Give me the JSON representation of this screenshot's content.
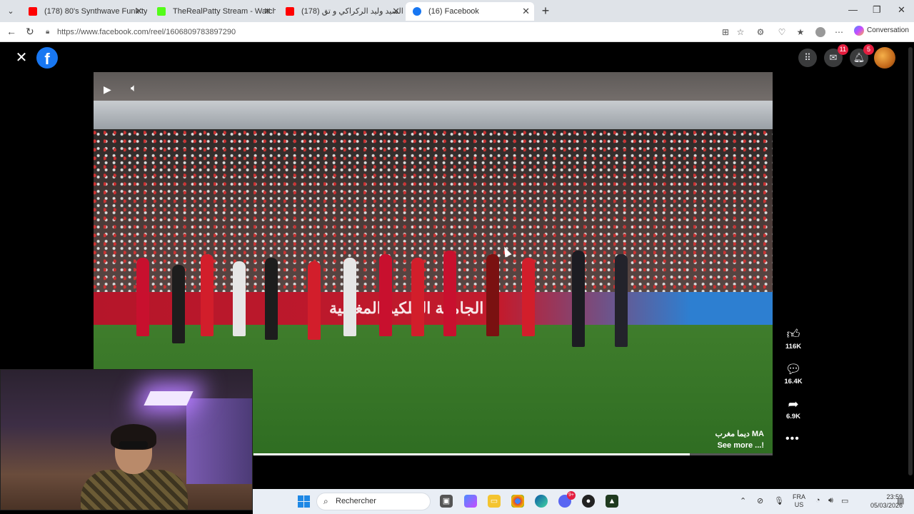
{
  "browser": {
    "tabs": [
      {
        "title": "(178) 80's Synthwave Funk type Be",
        "favicon": "youtube-icon",
        "color": "#ff0000"
      },
      {
        "title": "TheRealPatty Stream - Watch Live",
        "favicon": "kick-icon",
        "color": "#53fc18"
      },
      {
        "title": "(178) تكريم السيد وليد الركراكي و تق",
        "favicon": "youtube-icon",
        "color": "#ff0000"
      },
      {
        "title": "(16) Facebook",
        "favicon": "facebook-icon",
        "color": "#1877f2"
      }
    ],
    "url": "https://www.facebook.com/reel/1606809783897290",
    "conversation_label": "Conversation"
  },
  "facebook": {
    "messenger_badge": "11",
    "notifications_badge": "5",
    "reel": {
      "likes": "116K",
      "comments": "16.4K",
      "shares": "6.9K",
      "author": "ديما مغرب MA",
      "see_more": "See more ...!",
      "board_text": "الجامعة الملكية المغربية",
      "progress": 0.84
    }
  },
  "taskbar": {
    "search_placeholder": "Rechercher",
    "discord_badge": "9+",
    "lang_top": "FRA",
    "lang_bottom": "US",
    "time": "23:59",
    "date": "05/03/2026"
  }
}
